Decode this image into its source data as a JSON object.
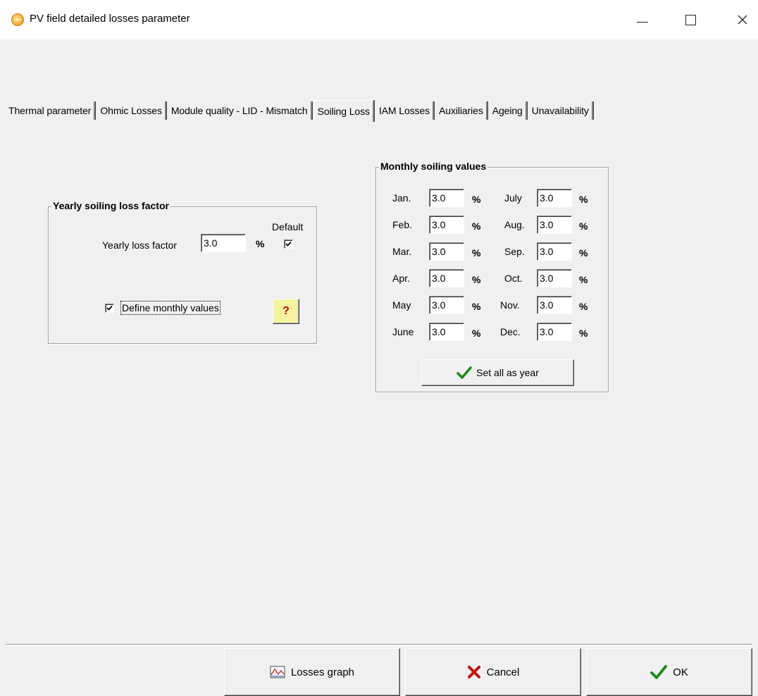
{
  "window": {
    "title": "PV field detailed losses parameter"
  },
  "tabs": [
    {
      "label": "Thermal parameter",
      "active": false
    },
    {
      "label": "Ohmic Losses",
      "active": false
    },
    {
      "label": "Module quality - LID - Mismatch",
      "active": false
    },
    {
      "label": "Soiling Loss",
      "active": true
    },
    {
      "label": "IAM Losses",
      "active": false
    },
    {
      "label": "Auxiliaries",
      "active": false
    },
    {
      "label": "Ageing",
      "active": false
    },
    {
      "label": "Unavailability",
      "active": false
    }
  ],
  "yearly": {
    "title": "Yearly soiling loss factor",
    "loss_label": "Yearly loss factor",
    "loss_value": "3.0",
    "unit": "%",
    "default_label": "Default",
    "default_checked": true,
    "monthly_label": "Define monthly values",
    "monthly_checked": true,
    "help_label": "?"
  },
  "monthly": {
    "title": "Monthly soiling values",
    "unit": "%",
    "left": [
      {
        "month": "Jan.",
        "value": "3.0"
      },
      {
        "month": "Feb.",
        "value": "3.0"
      },
      {
        "month": "Mar.",
        "value": "3.0"
      },
      {
        "month": "Apr.",
        "value": "3.0"
      },
      {
        "month": "May",
        "value": "3.0"
      },
      {
        "month": "June",
        "value": "3.0"
      }
    ],
    "right": [
      {
        "month": "July",
        "value": "3.0"
      },
      {
        "month": "Aug.",
        "value": "3.0"
      },
      {
        "month": "Sep.",
        "value": "3.0"
      },
      {
        "month": "Oct.",
        "value": "3.0"
      },
      {
        "month": "Nov.",
        "value": "3.0"
      },
      {
        "month": "Dec.",
        "value": "3.0"
      }
    ],
    "set_all_label": "Set all as year"
  },
  "footer": {
    "losses_graph_label": "Losses graph",
    "cancel_label": "Cancel",
    "ok_label": "OK"
  },
  "colors": {
    "check_green": "#1a8a1a",
    "cancel_red": "#c01010",
    "help_red": "#d00000"
  }
}
